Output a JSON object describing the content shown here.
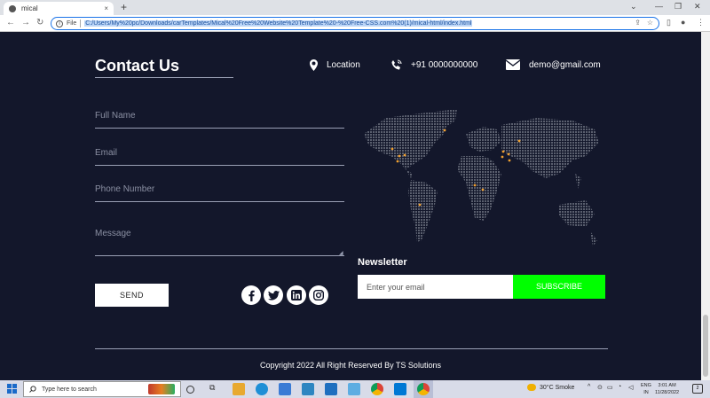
{
  "browser": {
    "tab_title": "mical",
    "tab_close": "×",
    "new_tab": "+",
    "scheme_label": "File",
    "url": "C:/Users/My%20pc/Downloads/carTemplates/Mical%20Free%20Website%20Template%20-%20Free-CSS.com%20(1)/mical-html/index.html"
  },
  "contact": {
    "title": "Contact Us",
    "location": "Location",
    "phone": "+91 0000000000",
    "email": "demo@gmail.com"
  },
  "form": {
    "full_name_placeholder": "Full Name",
    "email_placeholder": "Email",
    "phone_placeholder": "Phone Number",
    "message_placeholder": "Message",
    "send_label": "SEND"
  },
  "social": [
    "facebook-icon",
    "twitter-icon",
    "linkedin-icon",
    "instagram-icon"
  ],
  "newsletter": {
    "title": "Newsletter",
    "email_placeholder": "Enter your email",
    "subscribe_label": "SUBSCRIBE"
  },
  "footer": {
    "copyright": "Copyright 2022 All Right Reserved By TS Solutions"
  },
  "taskbar": {
    "search_placeholder": "Type here to search",
    "weather": "30°C  Smoke",
    "lang_line1": "ENG",
    "lang_line2": "IN",
    "time": "3:01 AM",
    "date": "11/28/2022",
    "notifications": "2"
  },
  "colors": {
    "page_bg": "#13172b",
    "subscribe_bg": "#00ff00",
    "map_dot": "#f0a030"
  }
}
